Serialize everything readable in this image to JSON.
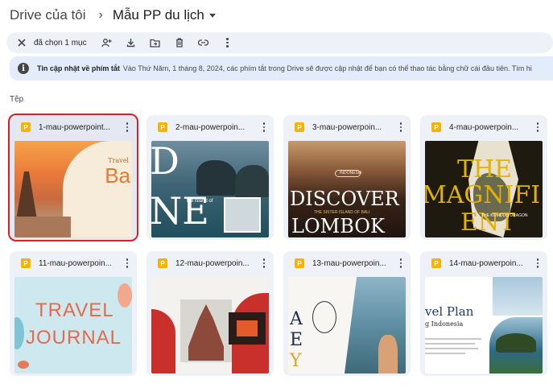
{
  "breadcrumb": {
    "root": "Drive của tôi",
    "separator": "›",
    "current": "Mẫu PP du lịch"
  },
  "selection_bar": {
    "count_label": "đã chọn 1 mục"
  },
  "banner": {
    "title": "Tin cập nhật về phím tắt",
    "body": "Vào Thứ Năm, 1 tháng 8, 2024, các phím tắt trong Drive sẽ được cập nhật để bạn có thể thao tác bằng chữ cái đầu tiên. Tìm hi"
  },
  "files_label": "Tệp",
  "files": [
    {
      "name": "1-mau-powerpoint...",
      "badge": "P",
      "selected": true,
      "thumb_text": [
        "Travel",
        "Ba"
      ]
    },
    {
      "name": "2-mau-powerpoin...",
      "badge": "P",
      "selected": false,
      "thumb_text": [
        "D",
        "NE",
        "the island of"
      ]
    },
    {
      "name": "3-mau-powerpoin...",
      "badge": "P",
      "selected": false,
      "thumb_text": [
        "INDONESIA",
        "DISCOVER",
        "THE SISTER ISLAND OF BALI",
        "LOMBOK"
      ]
    },
    {
      "name": "4-mau-powerpoin...",
      "badge": "P",
      "selected": false,
      "thumb_text": [
        "THE",
        "MAGNIFI",
        "ENT",
        "THE KOMODO DRAGON"
      ]
    },
    {
      "name": "11-mau-powerpoin...",
      "badge": "P",
      "selected": false,
      "thumb_text": [
        "TRAVEL",
        "JOURNAL"
      ]
    },
    {
      "name": "12-mau-powerpoin...",
      "badge": "P",
      "selected": false,
      "thumb_text": []
    },
    {
      "name": "13-mau-powerpoin...",
      "badge": "P",
      "selected": false,
      "thumb_text": [
        "A",
        "E",
        "Y"
      ]
    },
    {
      "name": "14-mau-powerpoin...",
      "badge": "P",
      "selected": false,
      "thumb_text": [
        "vel Plan",
        "g Indonesia"
      ]
    }
  ],
  "colors": {
    "selected_outline": "#d3232a",
    "card_bg": "#eef1f7",
    "banner_bg": "#e3ecfb",
    "ppt_badge": "#f6b300"
  }
}
